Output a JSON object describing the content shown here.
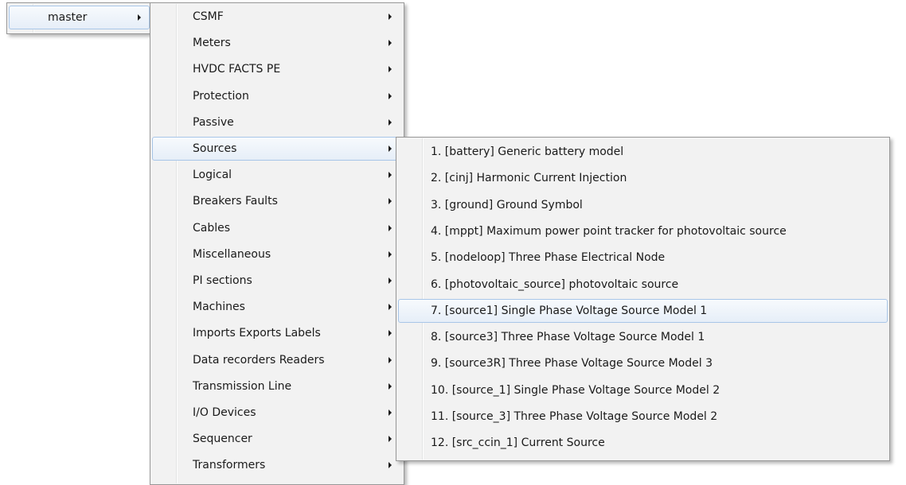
{
  "menu_l1": {
    "items": [
      {
        "label": "master",
        "has_submenu": true,
        "active": true
      }
    ]
  },
  "menu_l2": {
    "items": [
      {
        "label": "CSMF",
        "has_submenu": true
      },
      {
        "label": "Meters",
        "has_submenu": true
      },
      {
        "label": "HVDC FACTS PE",
        "has_submenu": true
      },
      {
        "label": "Protection",
        "has_submenu": true
      },
      {
        "label": "Passive",
        "has_submenu": true
      },
      {
        "label": "Sources",
        "has_submenu": true,
        "active": true
      },
      {
        "label": "Logical",
        "has_submenu": true
      },
      {
        "label": "Breakers Faults",
        "has_submenu": true
      },
      {
        "label": "Cables",
        "has_submenu": true
      },
      {
        "label": "Miscellaneous",
        "has_submenu": true
      },
      {
        "label": "PI sections",
        "has_submenu": true
      },
      {
        "label": "Machines",
        "has_submenu": true
      },
      {
        "label": "Imports Exports Labels",
        "has_submenu": true
      },
      {
        "label": "Data recorders Readers",
        "has_submenu": true
      },
      {
        "label": "Transmission Line",
        "has_submenu": true
      },
      {
        "label": "I/O Devices",
        "has_submenu": true
      },
      {
        "label": "Sequencer",
        "has_submenu": true
      },
      {
        "label": "Transformers",
        "has_submenu": true
      }
    ]
  },
  "menu_l3": {
    "items": [
      {
        "label": "1. [battery] Generic battery model"
      },
      {
        "label": "2. [cinj] Harmonic Current Injection"
      },
      {
        "label": "3. [ground] Ground Symbol"
      },
      {
        "label": "4. [mppt] Maximum power point tracker for photovoltaic source"
      },
      {
        "label": "5. [nodeloop] Three Phase Electrical Node"
      },
      {
        "label": "6. [photovoltaic_source] photovoltaic source"
      },
      {
        "label": "7. [source1] Single Phase Voltage Source Model 1",
        "active": true
      },
      {
        "label": "8. [source3] Three Phase Voltage Source Model 1"
      },
      {
        "label": "9. [source3R] Three Phase Voltage Source Model 3"
      },
      {
        "label": "10. [source_1] Single Phase Voltage Source Model 2"
      },
      {
        "label": "11. [source_3] Three Phase Voltage Source Model 2"
      },
      {
        "label": "12. [src_ccin_1] Current Source"
      }
    ]
  },
  "colors": {
    "menu_background": "#f2f2f2",
    "menu_border": "#979797",
    "highlight_border": "#a8c6e8"
  }
}
